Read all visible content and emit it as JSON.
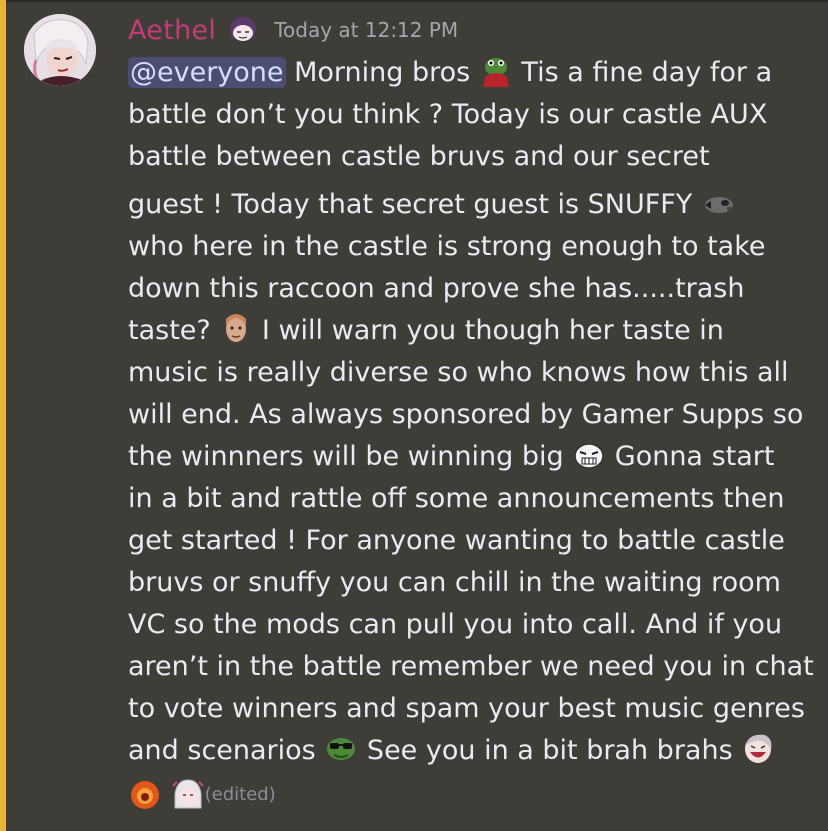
{
  "author": {
    "name": "Aethel",
    "timestamp": "Today at 12:12 PM"
  },
  "message": {
    "mention": "@everyone",
    "lines": [
      " Morning bros ",
      " Tis a fine day for  a",
      "battle don’t you think ? Today is our castle AUX",
      "battle between castle bruvs and our secret",
      "guest ! Today that secret guest is SNUFFY ",
      "who here in the castle is strong enough to take",
      "down this raccoon and prove she has.....trash",
      "taste? ",
      " I will warn you though her taste in",
      "music is really diverse so who knows how this all",
      "will end. As always sponsored by Gamer Supps so",
      "the winnners will be winning big ",
      " Gonna start",
      "in a bit and rattle off some announcements then",
      "get started ! For anyone wanting to battle castle",
      "bruvs or snuffy you can chill in the waiting room",
      "VC so the mods can pull you into call. And if you",
      "aren’t in the battle remember we need you in chat",
      "to vote winners and spam your best music genres",
      "and scenarios  ",
      " See you in a bit brah brahs "
    ],
    "edited_label": "(edited)"
  },
  "emojis": {
    "role": "anime-girl-emoji",
    "e1": "frog-emoji",
    "e2": "raccoon-emoji",
    "e3": "face-emoji",
    "e4": "grimace-emoji",
    "e5": "cool-frog-emoji",
    "e6": "laughing-emoji",
    "e7": "fire-emoji",
    "e8": "anime-emoji"
  },
  "colors": {
    "highlight_bar": "#e8b437",
    "username": "#c23c76",
    "mention_bg": "#4b4e72",
    "background": "#3f3d38"
  }
}
